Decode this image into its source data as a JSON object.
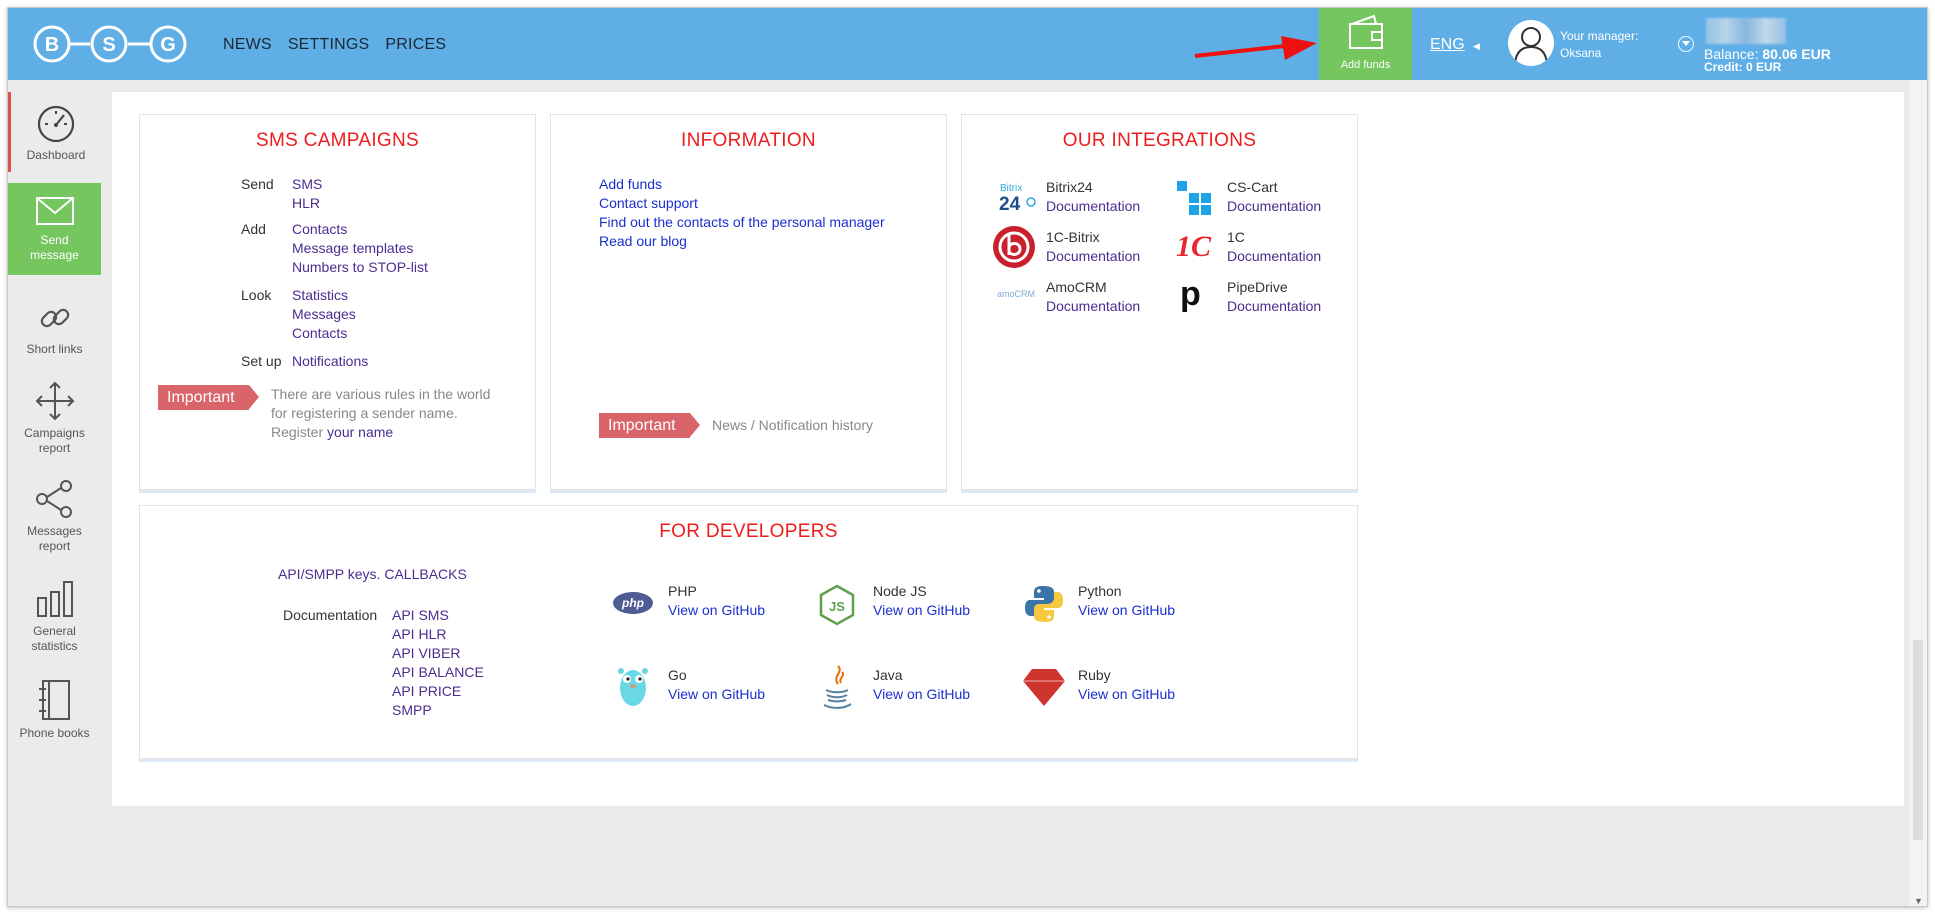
{
  "header": {
    "logo_letters": [
      "B",
      "S",
      "G"
    ],
    "nav": [
      "NEWS",
      "SETTINGS",
      "PRICES"
    ],
    "add_funds": "Add funds",
    "lang": "ENG",
    "manager_label": "Your manager:",
    "manager_name": "Oksana",
    "balance_label": "Balance:",
    "balance_value": "80.06 EUR",
    "credit": "Credit: 0 EUR"
  },
  "sidebar": {
    "items": [
      "Dashboard",
      "Send message",
      "Short links",
      "Campaigns report",
      "Messages report",
      "General statistics",
      "Phone books"
    ]
  },
  "sms": {
    "title": "SMS CAMPAIGNS",
    "send_label": "Send",
    "send": [
      "SMS",
      "HLR"
    ],
    "add_label": "Add",
    "add": [
      "Contacts",
      "Message templates",
      "Numbers to STOP-list"
    ],
    "look_label": "Look",
    "look": [
      "Statistics",
      "Messages",
      "Contacts"
    ],
    "setup_label": "Set up",
    "setup": "Notifications",
    "important": "Important",
    "note1": "There are various rules in the world",
    "note2": "for registering a sender name.",
    "note3": "Register",
    "note_link": "your name"
  },
  "info": {
    "title": "INFORMATION",
    "links": [
      "Add funds",
      "Contact support",
      "Find out the contacts of the personal manager",
      "Read our blog"
    ],
    "important": "Important",
    "history": "News / Notification history"
  },
  "integrations": {
    "title": "OUR INTEGRATIONS",
    "items": [
      {
        "name": "Bitrix24",
        "doc": "Documentation"
      },
      {
        "name": "CS-Cart",
        "doc": "Documentation"
      },
      {
        "name": "1C-Bitrix",
        "doc": "Documentation"
      },
      {
        "name": "1C",
        "doc": "Documentation"
      },
      {
        "name": "AmoCRM",
        "doc": "Documentation"
      },
      {
        "name": "PipeDrive",
        "doc": "Documentation"
      }
    ],
    "icon_text": {
      "bitrix_top": "Bitrix",
      "bitrix_num": "24",
      "onec": "1C",
      "amo": "amoCRM.",
      "pipe": "p"
    }
  },
  "dev": {
    "title": "FOR DEVELOPERS",
    "keys": "API/SMPP keys. CALLBACKS",
    "doc_label": "Documentation",
    "docs": [
      "API SMS",
      "API HLR",
      "API VIBER",
      "API BALANCE",
      "API PRICE",
      "SMPP"
    ],
    "langs": [
      {
        "name": "PHP",
        "link": "View on GitHub",
        "icon": "php-icon"
      },
      {
        "name": "Node JS",
        "link": "View on GitHub",
        "icon": "nodejs-icon"
      },
      {
        "name": "Python",
        "link": "View on GitHub",
        "icon": "python-icon"
      },
      {
        "name": "Go",
        "link": "View on GitHub",
        "icon": "go-icon"
      },
      {
        "name": "Java",
        "link": "View on GitHub",
        "icon": "java-icon"
      },
      {
        "name": "Ruby",
        "link": "View on GitHub",
        "icon": "ruby-icon"
      }
    ],
    "php_text": "php"
  },
  "colors": {
    "header": "#5fafe6",
    "add_funds": "#76c660",
    "title_red": "#ee1c1c",
    "link_purple": "#4b2d8f",
    "link_blue": "#1a2fcf",
    "important": "#d9656b"
  }
}
